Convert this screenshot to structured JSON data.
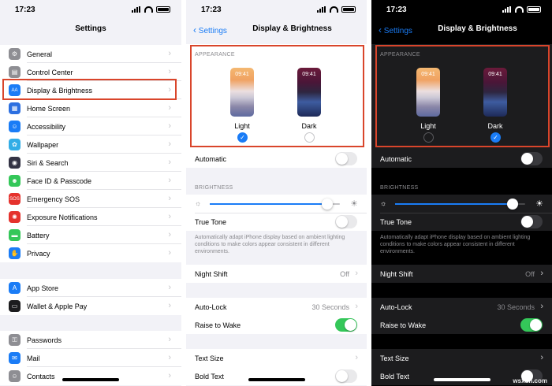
{
  "settings": {
    "status_time": "17:23",
    "title": "Settings",
    "group1": [
      {
        "label": "General",
        "icon": "gear-icon",
        "color": "#8e8e93",
        "glyph": "⚙"
      },
      {
        "label": "Control Center",
        "icon": "control-center-icon",
        "color": "#8e8e93",
        "glyph": "▤"
      },
      {
        "label": "Display & Brightness",
        "icon": "display-icon",
        "color": "#1a7cf6",
        "glyph": "AA"
      },
      {
        "label": "Home Screen",
        "icon": "home-screen-icon",
        "color": "#2c6fe0",
        "glyph": "▦"
      },
      {
        "label": "Accessibility",
        "icon": "accessibility-icon",
        "color": "#1a7cf6",
        "glyph": "☺"
      },
      {
        "label": "Wallpaper",
        "icon": "wallpaper-icon",
        "color": "#32ade6",
        "glyph": "✿"
      },
      {
        "label": "Siri & Search",
        "icon": "siri-icon",
        "color": "#333344",
        "glyph": "◉"
      },
      {
        "label": "Face ID & Passcode",
        "icon": "face-id-icon",
        "color": "#34c759",
        "glyph": "☻"
      },
      {
        "label": "Emergency SOS",
        "icon": "sos-icon",
        "color": "#e5322d",
        "glyph": "SOS"
      },
      {
        "label": "Exposure Notifications",
        "icon": "exposure-icon",
        "color": "#e5322d",
        "glyph": "✺"
      },
      {
        "label": "Battery",
        "icon": "battery-icon",
        "color": "#34c759",
        "glyph": "▬"
      },
      {
        "label": "Privacy",
        "icon": "privacy-icon",
        "color": "#1a7cf6",
        "glyph": "✋"
      }
    ],
    "group2": [
      {
        "label": "App Store",
        "icon": "app-store-icon",
        "color": "#1a7cf6",
        "glyph": "A"
      },
      {
        "label": "Wallet & Apple Pay",
        "icon": "wallet-icon",
        "color": "#1c1c1e",
        "glyph": "▭"
      }
    ],
    "group3": [
      {
        "label": "Passwords",
        "icon": "key-icon",
        "color": "#8e8e93",
        "glyph": "⚿"
      },
      {
        "label": "Mail",
        "icon": "mail-icon",
        "color": "#1a7cf6",
        "glyph": "✉"
      },
      {
        "label": "Contacts",
        "icon": "contacts-icon",
        "color": "#8e8e93",
        "glyph": "☺"
      }
    ]
  },
  "display": {
    "status_time": "17:23",
    "back_label": "Settings",
    "title": "Display & Brightness",
    "appearance_header": "APPEARANCE",
    "phone_time": "09:41",
    "light_label": "Light",
    "dark_label": "Dark",
    "automatic_label": "Automatic",
    "brightness_header": "BRIGHTNESS",
    "brightness_level": 0.9,
    "true_tone_label": "True Tone",
    "true_tone_footer": "Automatically adapt iPhone display based on ambient lighting conditions to make colors appear consistent in different environments.",
    "night_shift_label": "Night Shift",
    "night_shift_value": "Off",
    "auto_lock_label": "Auto-Lock",
    "auto_lock_value": "30 Seconds",
    "raise_to_wake_label": "Raise to Wake",
    "text_size_label": "Text Size",
    "bold_text_label": "Bold Text"
  },
  "watermark": "wsxdn.com"
}
